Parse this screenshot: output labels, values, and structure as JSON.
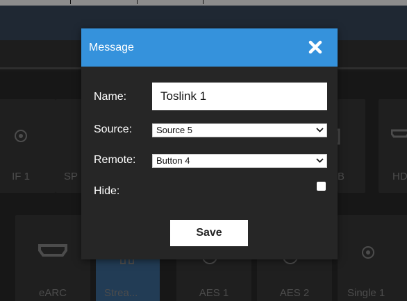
{
  "background": {
    "upper_row": [
      {
        "label": "IF 1",
        "icon": "circle-icon"
      },
      {
        "label": "SP",
        "icon": "blank"
      },
      {
        "label": "B",
        "icon": "plug-icon"
      },
      {
        "label": "HD",
        "icon": "hdmi-icon"
      }
    ],
    "lower_row": [
      {
        "label": "eARC",
        "icon": "hdmi-icon"
      },
      {
        "label": "Strea...",
        "icon": "stream-icon"
      },
      {
        "label": "AES 1",
        "icon": "circle-icon"
      },
      {
        "label": "AES 2",
        "icon": "circle-icon"
      },
      {
        "label": "Single 1",
        "icon": "circle-icon"
      }
    ]
  },
  "modal": {
    "title": "Message",
    "close_icon": "close-icon",
    "name_label": "Name:",
    "name_value": "Toslink 1",
    "source_label": "Source:",
    "source_value": "Source 5",
    "remote_label": "Remote:",
    "remote_value": "Button 4",
    "hide_label": "Hide:",
    "hide_checked": false,
    "save_label": "Save"
  },
  "colors": {
    "modal_header": "#3592dc",
    "modal_body": "#262626",
    "active_tile": "#3e6e9c"
  }
}
